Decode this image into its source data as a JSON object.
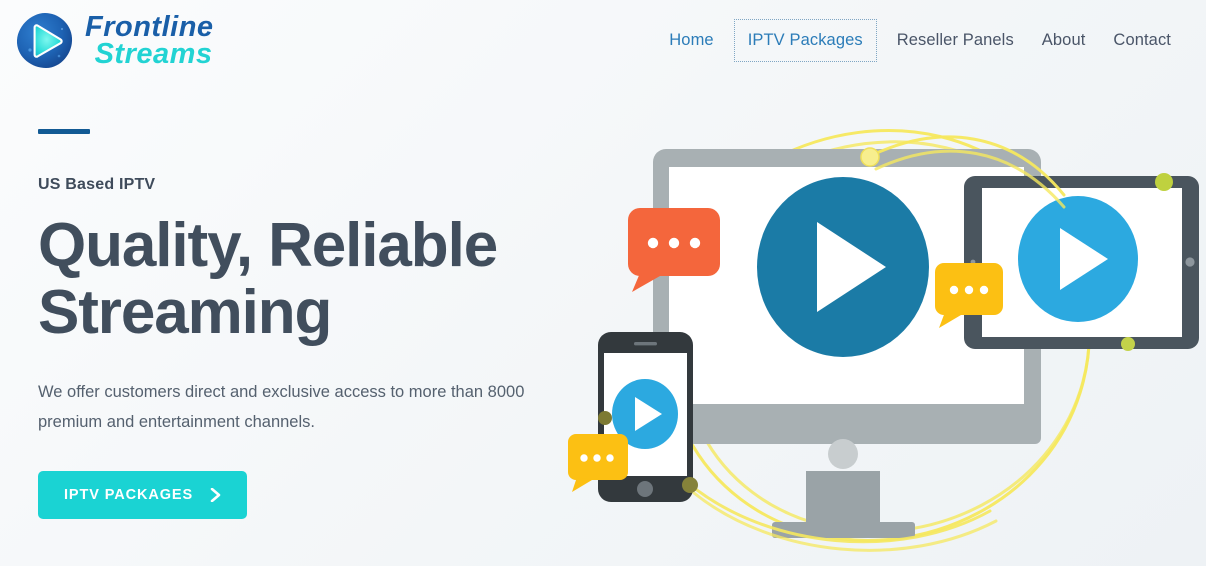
{
  "brand": {
    "logo_icon": "play-logo-icon",
    "line1": "Frontline",
    "line2": "Streams"
  },
  "nav": {
    "items": [
      {
        "label": "Home",
        "state": "active"
      },
      {
        "label": "IPTV Packages",
        "state": "focused"
      },
      {
        "label": "Reseller Panels",
        "state": "default"
      },
      {
        "label": "About",
        "state": "default"
      },
      {
        "label": "Contact",
        "state": "default"
      }
    ]
  },
  "hero": {
    "eyebrow": "US Based IPTV",
    "title_line1": "Quality, Reliable",
    "title_line2": "Streaming",
    "subtitle": "We offer customers direct and exclusive access to more than 8000 premium and entertainment channels.",
    "cta_label": "IPTV PACKAGES",
    "cta_icon": "chevron-right-icon",
    "illustration": {
      "name": "multi-device-streaming-illustration",
      "devices": [
        "desktop-monitor",
        "tablet",
        "smartphone"
      ],
      "bubbles": [
        "orange-chat-bubble",
        "yellow-chat-bubble-tablet",
        "yellow-chat-bubble-phone"
      ],
      "orbit": "yellow-orbit-rings"
    }
  },
  "colors": {
    "page_background": "#f5f7f9",
    "brand_blue": "#1a5fa8",
    "brand_cyan": "#22d3d3",
    "nav_active": "#2b7cb8",
    "nav_default": "#4a5568",
    "heading": "#414e5d",
    "body_text": "#55616f",
    "rule_blue": "#125a94",
    "cta_background": "#1ad3d3",
    "monitor_gray": "#a8b0b3",
    "play_dark_blue": "#1b7ba6",
    "play_light_blue": "#2ca9e0",
    "tablet_frame": "#4a555e",
    "phone_frame": "#33393d",
    "bubble_orange": "#f4663c",
    "bubble_yellow": "#fcc013",
    "orbit_yellow": "#f5e85e"
  }
}
